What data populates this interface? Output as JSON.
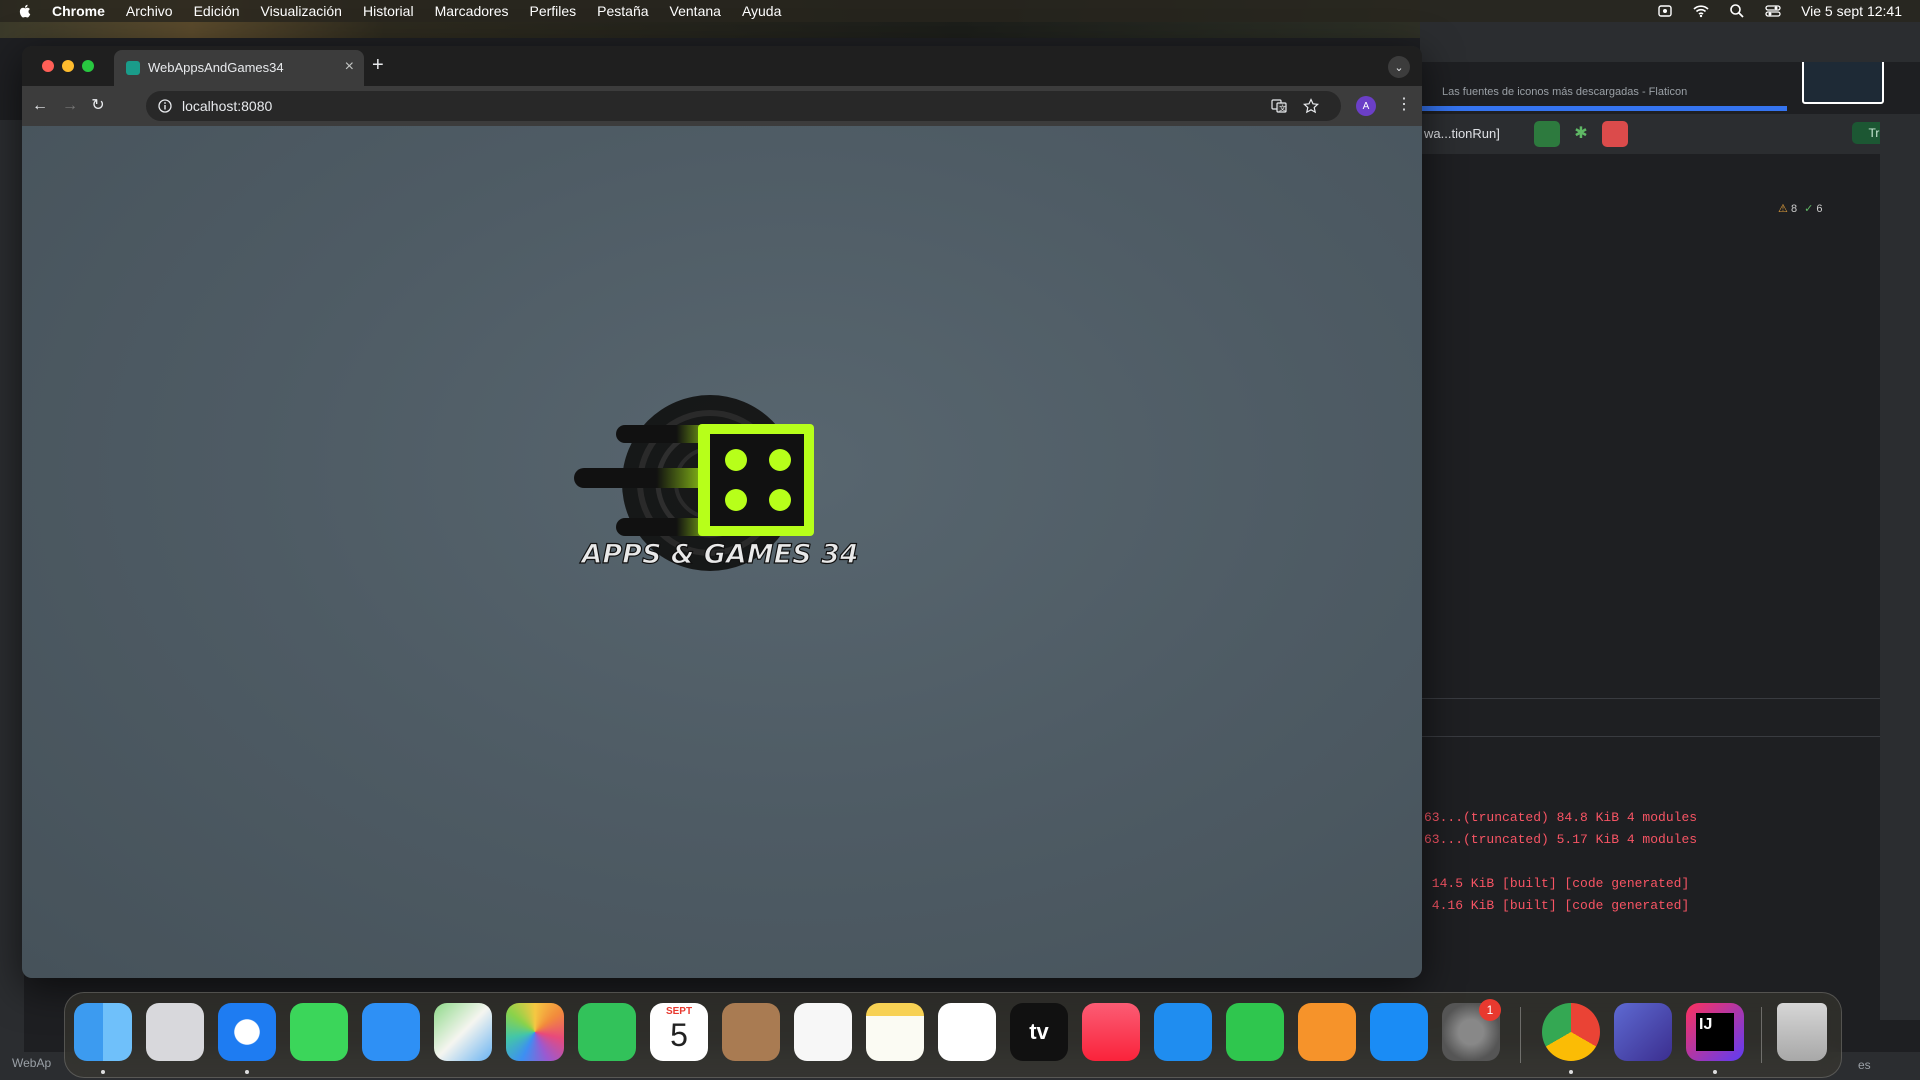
{
  "menubar": {
    "app": "Chrome",
    "items": [
      "Archivo",
      "Edición",
      "Visualización",
      "Historial",
      "Marcadores",
      "Perfiles",
      "Pestaña",
      "Ventana",
      "Ayuda"
    ],
    "clock": "Vie 5 sept 12:41"
  },
  "browser": {
    "tab_title": "WebAppsAndGames34",
    "url": "localhost:8080",
    "avatar_letter": "A"
  },
  "page": {
    "logo_text": "APPS & GAMES 34",
    "logo_colors": {
      "accent": "#b7ff1a",
      "dark": "#111111"
    }
  },
  "ide": {
    "background_tab": "Las fuentes de iconos más descargadas - Flaticon",
    "run_config": "wa...tionRun]",
    "trial_label": "Trial",
    "warnings": "8",
    "checks": "6",
    "console_lines": [
      "63...(truncated) 84.8 KiB 4 modules",
      "63...(truncated) 5.17 KiB 4 modules",
      " 14.5 KiB [built] [code generated]",
      " 4.16 KiB [built] [code generated]"
    ],
    "status_left": "WebAp",
    "status_right": "es"
  },
  "dock": {
    "calendar_month": "SEPT",
    "calendar_day": "5",
    "tv_label": "tv",
    "settings_badge": "1",
    "intellij_label": "IJ",
    "items": [
      "finder",
      "launchpad",
      "safari",
      "messages",
      "mail",
      "maps",
      "photos",
      "facetime",
      "calendar",
      "contacts",
      "reminders",
      "notes",
      "freeform",
      "apple-tv",
      "music",
      "keynote",
      "numbers",
      "pages",
      "app-store",
      "system-settings",
      "chrome",
      "linear",
      "intellij",
      "trash"
    ]
  }
}
